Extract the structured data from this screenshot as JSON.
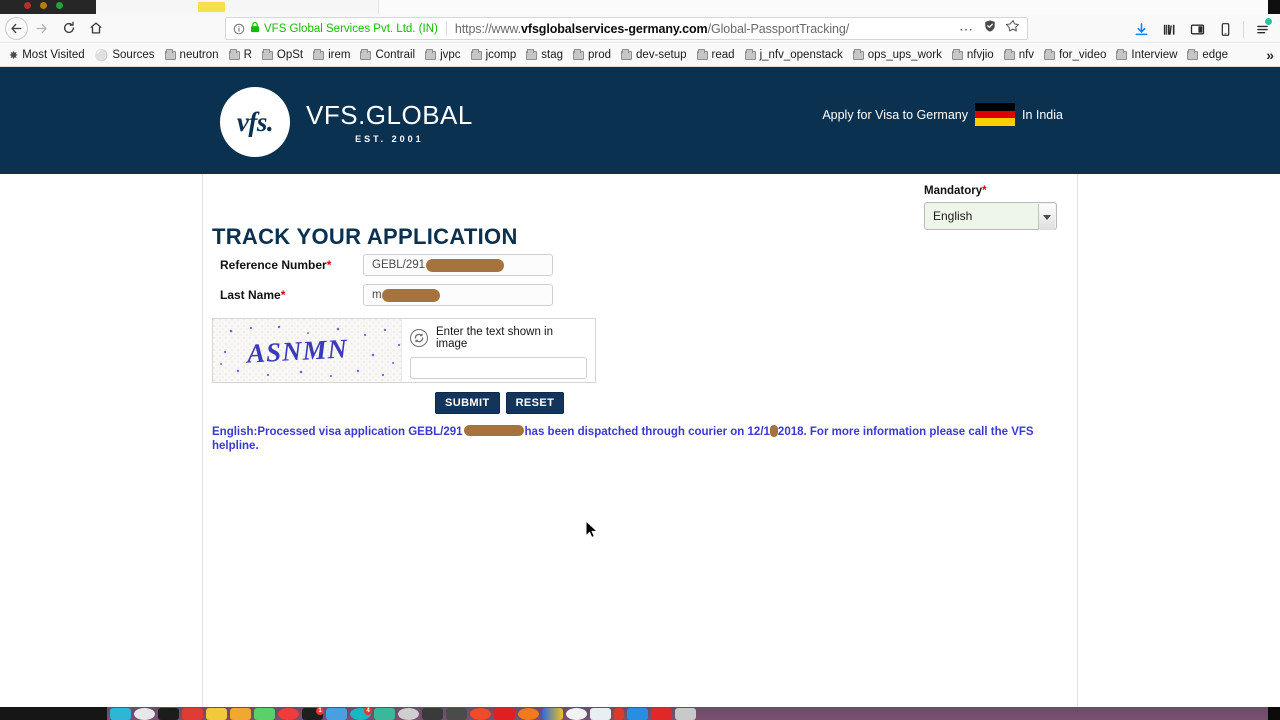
{
  "browser": {
    "nav": {
      "back_label": "Back",
      "forward_label": "Forward",
      "reload_label": "Reload",
      "home_label": "Home"
    },
    "url": {
      "identity_org": "VFS Global Services Pvt. Ltd. (IN)",
      "domain": "https://www.vfsglobalservices-germany.com",
      "domain_bold": "vfsglobalservices-germany.com",
      "scheme_prefix": "https://www.",
      "path": "/Global-PassportTracking/",
      "full": "https://www.vfsglobalservices-germany.com/Global-PassportTracking/"
    },
    "toolbar_right": [
      "download-icon",
      "library-icon",
      "sidebar-icon",
      "reader-icon",
      "menu-icon"
    ],
    "bookmarks": [
      {
        "label": "Most Visited",
        "icon": "star-icon"
      },
      {
        "label": "Sources",
        "icon": "globe-icon"
      },
      {
        "label": "neutron",
        "icon": "folder-icon"
      },
      {
        "label": "R",
        "icon": "folder-icon"
      },
      {
        "label": "OpSt",
        "icon": "folder-icon"
      },
      {
        "label": "irem",
        "icon": "folder-icon"
      },
      {
        "label": "Contrail",
        "icon": "folder-icon"
      },
      {
        "label": "jvpc",
        "icon": "folder-icon"
      },
      {
        "label": "jcomp",
        "icon": "folder-icon"
      },
      {
        "label": "stag",
        "icon": "folder-icon"
      },
      {
        "label": "prod",
        "icon": "folder-icon"
      },
      {
        "label": "dev-setup",
        "icon": "folder-icon"
      },
      {
        "label": "read",
        "icon": "folder-icon"
      },
      {
        "label": "j_nfv_openstack",
        "icon": "folder-icon"
      },
      {
        "label": "ops_ups_work",
        "icon": "folder-icon"
      },
      {
        "label": "nfvjio",
        "icon": "folder-icon"
      },
      {
        "label": "nfv",
        "icon": "folder-icon"
      },
      {
        "label": "for_video",
        "icon": "folder-icon"
      },
      {
        "label": "Interview",
        "icon": "folder-icon"
      },
      {
        "label": "edge",
        "icon": "folder-icon"
      }
    ],
    "bookmarks_overflow": "»"
  },
  "site": {
    "header": {
      "logo_mark": "vfs.",
      "logo_name": "VFS.GLOBAL",
      "logo_tagline": "EST. 2001",
      "apply_text": "Apply for Visa to Germany",
      "country_text": "In India",
      "flag": "germany-flag-icon",
      "bg_color": "#0b3150"
    },
    "language": {
      "mandatory_label": "Mandatory",
      "mandatory_asterisk": "*",
      "selected": "English",
      "options": [
        "English"
      ]
    },
    "page_title": "TRACK YOUR APPLICATION",
    "form": {
      "fields": [
        {
          "label": "Reference Number",
          "asterisk": "*",
          "value": "GEBL/291",
          "redacted": true
        },
        {
          "label": "Last Name",
          "asterisk": "*",
          "value": "m",
          "redacted": true
        }
      ],
      "captcha": {
        "image_text": "ASNMN",
        "refresh_icon": "refresh-icon",
        "prompt": "Enter the text shown in image",
        "input_value": ""
      },
      "buttons": [
        {
          "label": "SUBMIT",
          "name": "submit-button"
        },
        {
          "label": "RESET",
          "name": "reset-button"
        }
      ]
    },
    "status": {
      "part1": "English:Processed visa application GEBL/291",
      "part2": "has been dispatched through courier on 12/1",
      "part3": "2018. For more information please call the VFS helpline.",
      "color": "#3a3ad0"
    }
  },
  "colors": {
    "brand_navy": "#0b3150",
    "button_navy": "#13355c",
    "asterisk_red": "#d40000",
    "captcha_blue": "#3b3bb8",
    "redaction": "#a5743e",
    "select_green": "#eef5e9"
  }
}
